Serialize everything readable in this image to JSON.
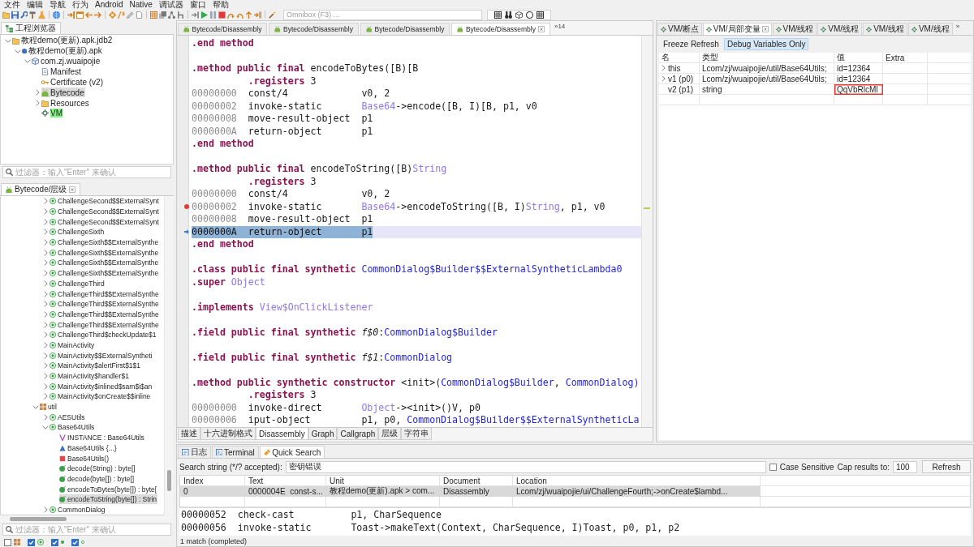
{
  "menu": [
    "文件",
    "编辑",
    "导航",
    "行为",
    "Android",
    "Native",
    "调试器",
    "窗口",
    "帮助"
  ],
  "toolbar": {
    "omnibox": {
      "placeholder": "Omnibox (F3) ..."
    }
  },
  "project_explorer": {
    "tab": "工程浏览器",
    "tree": [
      {
        "label": "教程demo(更新).apk.jdb2",
        "kind": "project",
        "expanded": true,
        "selected": false,
        "highlighted": false,
        "children": [
          {
            "label": "教程demo(更新).apk",
            "kind": "apk",
            "expanded": true,
            "selected": false,
            "highlighted": false,
            "children": [
              {
                "label": "com.zj.wuaipojie",
                "kind": "package-root",
                "expanded": true,
                "selected": false,
                "highlighted": false,
                "children": [
                  {
                    "label": "Manifest",
                    "kind": "manifest",
                    "selected": false,
                    "highlighted": false
                  },
                  {
                    "label": "Certificate (v2)",
                    "kind": "certificate",
                    "selected": false,
                    "highlighted": false
                  },
                  {
                    "label": "Bytecode",
                    "kind": "bytecode",
                    "expanded": false,
                    "selected": true,
                    "highlighted": false
                  },
                  {
                    "label": "Resources",
                    "kind": "resources",
                    "expanded": false,
                    "selected": false,
                    "highlighted": false
                  },
                  {
                    "label": "VM",
                    "kind": "vm",
                    "selected": false,
                    "highlighted": true
                  }
                ]
              }
            ]
          }
        ]
      }
    ],
    "filter": {
      "placeholder": "过滤器：输入\"Enter\" 来确认"
    }
  },
  "bytecode_hierarchy": {
    "tab": "Bytecode/层级",
    "continued_items": [
      {
        "label": "ChallengeSecond$$ExternalSynt",
        "kind": "class",
        "expanded": false,
        "selected": false
      },
      {
        "label": "ChallengeSecond$$ExternalSynt",
        "kind": "class",
        "expanded": false,
        "selected": false
      },
      {
        "label": "ChallengeSecond$$ExternalSynt",
        "kind": "class",
        "expanded": false,
        "selected": false
      },
      {
        "label": "ChallengeSixth",
        "kind": "class",
        "expanded": false,
        "selected": false
      },
      {
        "label": "ChallengeSixth$$ExternalSynthe",
        "kind": "class",
        "expanded": false,
        "selected": false
      },
      {
        "label": "ChallengeSixth$$ExternalSynthe",
        "kind": "class",
        "expanded": false,
        "selected": false
      },
      {
        "label": "ChallengeSixth$$ExternalSynthe",
        "kind": "class",
        "expanded": false,
        "selected": false
      },
      {
        "label": "ChallengeSixth$$ExternalSynthe",
        "kind": "class",
        "expanded": false,
        "selected": false
      },
      {
        "label": "ChallengeThird",
        "kind": "class",
        "expanded": false,
        "selected": false
      },
      {
        "label": "ChallengeThird$$ExternalSynthe",
        "kind": "class",
        "expanded": false,
        "selected": false
      },
      {
        "label": "ChallengeThird$$ExternalSynthe",
        "kind": "class",
        "expanded": false,
        "selected": false
      },
      {
        "label": "ChallengeThird$$ExternalSynthe",
        "kind": "class",
        "expanded": false,
        "selected": false
      },
      {
        "label": "ChallengeThird$$ExternalSynthe",
        "kind": "class",
        "expanded": false,
        "selected": false
      },
      {
        "label": "ChallengeThird$checkUpdate$1",
        "kind": "class",
        "expanded": false,
        "selected": false
      },
      {
        "label": "MainActivity",
        "kind": "class",
        "expanded": false,
        "selected": false
      },
      {
        "label": "MainActivity$$ExternalSyntheti",
        "kind": "class",
        "expanded": false,
        "selected": false
      },
      {
        "label": "MainActivity$alertFirst$1$1",
        "kind": "class",
        "expanded": false,
        "selected": false
      },
      {
        "label": "MainActivity$handler$1",
        "kind": "class",
        "expanded": false,
        "selected": false
      },
      {
        "label": "MainActivity$inlined$sam$i$an",
        "kind": "class",
        "expanded": false,
        "selected": false
      },
      {
        "label": "MainActivity$onCreate$$inline",
        "kind": "class",
        "expanded": false,
        "selected": false
      }
    ],
    "items": [
      {
        "label": "util",
        "kind": "package",
        "expanded": true,
        "selected": false,
        "children": [
          {
            "label": "AESUtils",
            "kind": "class",
            "expanded": false,
            "selected": false
          },
          {
            "label": "Base64Utils",
            "kind": "class",
            "expanded": true,
            "selected": false,
            "children": [
              {
                "label": "INSTANCE : Base64Utils",
                "kind": "field",
                "selected": false
              },
              {
                "label": "Base64Utils {...}",
                "kind": "static-init",
                "selected": false
              },
              {
                "label": "Base64Utils()",
                "kind": "constructor",
                "selected": false
              },
              {
                "label": "decode(String) : byte[]",
                "kind": "method",
                "selected": false
              },
              {
                "label": "decode(byte[]) : byte[]",
                "kind": "method",
                "selected": false
              },
              {
                "label": "encodeToBytes(byte[]) : byte[",
                "kind": "method",
                "selected": false
              },
              {
                "label": "encodeToString(byte[]) : Strin",
                "kind": "method",
                "selected": true
              }
            ]
          },
          {
            "label": "CommonDialog",
            "kind": "class",
            "expanded": false,
            "selected": false
          }
        ]
      }
    ],
    "filter": {
      "placeholder": "过滤器：输入\"Enter\" 来确认"
    },
    "filters": [
      {
        "kind": "package",
        "checked": false
      },
      {
        "kind": "class",
        "checked": true
      },
      {
        "kind": "method",
        "checked": true
      },
      {
        "kind": "field",
        "checked": true
      }
    ]
  },
  "editor": {
    "tabs": [
      {
        "label": "Bytecode/Disassembly",
        "selected": false
      },
      {
        "label": "Bytecode/Disassembly",
        "selected": false
      },
      {
        "label": "Bytecode/Disassembly",
        "selected": false
      },
      {
        "label": "Bytecode/Disassembly",
        "selected": true
      }
    ],
    "overflow": "»14",
    "lines": [
      {
        "kind": "directive",
        "tokens": [
          {
            "text": ".end method",
            "kind": "kw"
          }
        ]
      },
      {
        "kind": "blank"
      },
      {
        "kind": "directive",
        "tokens": [
          {
            "text": ".method public final",
            "kind": "kw"
          },
          {
            "text": " encodeToBytes([B)[B",
            "kind": "plain"
          }
        ]
      },
      {
        "kind": "nested",
        "tokens": [
          {
            "text": ".registers",
            "kind": "kw"
          },
          {
            "text": " 3",
            "kind": "plain"
          }
        ]
      },
      {
        "kind": "instruction",
        "address": "00000000",
        "op": "const/4",
        "args": [
          {
            "text": "v0, 2",
            "kind": "plain"
          }
        ],
        "breakpoint": false,
        "current": false
      },
      {
        "kind": "instruction",
        "address": "00000002",
        "op": "invoke-static",
        "args": [
          {
            "text": "Base64",
            "kind": "type"
          },
          {
            "text": "->encode([B, I)[B, p1, v0",
            "kind": "plain"
          }
        ],
        "breakpoint": false,
        "current": false
      },
      {
        "kind": "instruction",
        "address": "00000008",
        "op": "move-result-object",
        "args": [
          {
            "text": "p1",
            "kind": "plain"
          }
        ],
        "breakpoint": false,
        "current": false
      },
      {
        "kind": "instruction",
        "address": "0000000A",
        "op": "return-object",
        "args": [
          {
            "text": "p1",
            "kind": "plain"
          }
        ],
        "breakpoint": false,
        "current": false
      },
      {
        "kind": "directive",
        "tokens": [
          {
            "text": ".end method",
            "kind": "kw"
          }
        ]
      },
      {
        "kind": "blank"
      },
      {
        "kind": "directive",
        "tokens": [
          {
            "text": ".method public final",
            "kind": "kw"
          },
          {
            "text": " encodeToString([B)",
            "kind": "plain"
          },
          {
            "text": "String",
            "kind": "type"
          }
        ]
      },
      {
        "kind": "nested",
        "tokens": [
          {
            "text": ".registers",
            "kind": "kw"
          },
          {
            "text": " 3",
            "kind": "plain"
          }
        ]
      },
      {
        "kind": "instruction",
        "address": "00000000",
        "op": "const/4",
        "args": [
          {
            "text": "v0, 2",
            "kind": "plain"
          }
        ],
        "breakpoint": false,
        "current": false
      },
      {
        "kind": "instruction",
        "address": "00000002",
        "op": "invoke-static",
        "args": [
          {
            "text": "Base64",
            "kind": "type"
          },
          {
            "text": "->encodeToString([B, I)",
            "kind": "plain"
          },
          {
            "text": "String",
            "kind": "type"
          },
          {
            "text": ", p1, v0",
            "kind": "plain"
          }
        ],
        "breakpoint": true,
        "current": false
      },
      {
        "kind": "instruction",
        "address": "00000008",
        "op": "move-result-object",
        "args": [
          {
            "text": "p1",
            "kind": "plain"
          }
        ],
        "breakpoint": false,
        "current": false
      },
      {
        "kind": "instruction",
        "address": "0000000A",
        "op": "return-object",
        "args": [
          {
            "text": "p1",
            "kind": "plain"
          }
        ],
        "breakpoint": false,
        "current": true
      },
      {
        "kind": "directive",
        "tokens": [
          {
            "text": ".end method",
            "kind": "kw"
          }
        ]
      },
      {
        "kind": "blank"
      },
      {
        "kind": "directive",
        "tokens": [
          {
            "text": ".class public final synthetic",
            "kind": "kw"
          },
          {
            "text": " CommonDialog$Builder$$ExternalSyntheticLambda0",
            "kind": "ref"
          }
        ]
      },
      {
        "kind": "directive",
        "tokens": [
          {
            "text": ".super",
            "kind": "kw"
          },
          {
            "text": " Object",
            "kind": "type"
          }
        ]
      },
      {
        "kind": "blank"
      },
      {
        "kind": "directive",
        "tokens": [
          {
            "text": ".implements",
            "kind": "kw"
          },
          {
            "text": " View$OnClickListener",
            "kind": "type"
          }
        ]
      },
      {
        "kind": "blank"
      },
      {
        "kind": "directive",
        "tokens": [
          {
            "text": ".field public final synthetic",
            "kind": "kw"
          },
          {
            "text": " f$0",
            "kind": "name"
          },
          {
            "text": ":",
            "kind": "plain"
          },
          {
            "text": "CommonDialog$Builder",
            "kind": "ref"
          }
        ]
      },
      {
        "kind": "blank"
      },
      {
        "kind": "directive",
        "tokens": [
          {
            "text": ".field public final synthetic",
            "kind": "kw"
          },
          {
            "text": " f$1",
            "kind": "name"
          },
          {
            "text": ":",
            "kind": "plain"
          },
          {
            "text": "CommonDialog",
            "kind": "ref"
          }
        ]
      },
      {
        "kind": "blank"
      },
      {
        "kind": "directive",
        "tokens": [
          {
            "text": ".method public synthetic constructor",
            "kind": "kw"
          },
          {
            "text": " <init>(",
            "kind": "plain"
          },
          {
            "text": "CommonDialog$Builder",
            "kind": "ref"
          },
          {
            "text": ", ",
            "kind": "plain"
          },
          {
            "text": "CommonDialog)",
            "kind": "ref"
          }
        ]
      },
      {
        "kind": "nested",
        "tokens": [
          {
            "text": ".registers",
            "kind": "kw"
          },
          {
            "text": " 3",
            "kind": "plain"
          }
        ]
      },
      {
        "kind": "instruction",
        "address": "00000000",
        "op": "invoke-direct",
        "args": [
          {
            "text": "Object",
            "kind": "type"
          },
          {
            "text": "-><init>()V, p0",
            "kind": "plain"
          }
        ],
        "breakpoint": false,
        "current": false
      },
      {
        "kind": "instruction",
        "address": "00000006",
        "op": "iput-object",
        "args": [
          {
            "text": "p1, p0, ",
            "kind": "plain"
          },
          {
            "text": "CommonDialog$Builder$$ExternalSyntheticLa",
            "kind": "ref"
          }
        ],
        "breakpoint": false,
        "current": false
      }
    ],
    "view_tabs": [
      {
        "label": "描述",
        "selected": false
      },
      {
        "label": "十六进制格式",
        "selected": false
      },
      {
        "label": "Disassembly",
        "selected": true
      },
      {
        "label": "Graph",
        "selected": false
      },
      {
        "label": "Callgraph",
        "selected": false
      },
      {
        "label": "层级",
        "selected": false
      },
      {
        "label": "字符串",
        "selected": false
      }
    ]
  },
  "vm_panel": {
    "tabs": [
      {
        "label": "VM/断点",
        "selected": false
      },
      {
        "label": "VM/局部变量",
        "selected": true
      },
      {
        "label": "VM/线程",
        "selected": false
      },
      {
        "label": "VM/线程",
        "selected": false
      },
      {
        "label": "VM/线程",
        "selected": false
      },
      {
        "label": "VM/线程",
        "selected": false
      }
    ],
    "overflow": "»",
    "buttons": [
      {
        "label": "Freeze Refresh",
        "selected": false
      },
      {
        "label": "Debug Variables Only",
        "selected": true
      }
    ],
    "columns": [
      "名",
      "类型",
      "值",
      "Extra"
    ],
    "rows": [
      {
        "kind": "object",
        "expanded": false,
        "name": "this",
        "type": "Lcom/zj/wuaipojie/util/Base64Utils;",
        "value": "id=12364",
        "highlighted": false
      },
      {
        "kind": "object",
        "expanded": false,
        "name": "v1 (p0)",
        "type": "Lcom/zj/wuaipojie/util/Base64Utils;",
        "value": "id=12364",
        "highlighted": false
      },
      {
        "kind": "primitive",
        "name": "v2 (p1)",
        "type": "string",
        "value": "QqVbRlcMl",
        "highlighted": true
      }
    ]
  },
  "bottom_panel": {
    "tabs": [
      {
        "label": "日志",
        "kind": "log",
        "selected": false
      },
      {
        "label": "Terminal",
        "kind": "terminal",
        "selected": false
      },
      {
        "label": "Quick Search",
        "kind": "search",
        "selected": true
      }
    ],
    "search": {
      "label": "Search string (*/? accepted):",
      "value": "密钥错误",
      "case_sensitive": {
        "label": "Case Sensitive",
        "checked": false
      },
      "cap_label": "Cap results to:",
      "cap_value": "100",
      "button": "Refresh"
    },
    "results": {
      "columns": [
        "Index",
        "Text",
        "Unit",
        "Document",
        "Location"
      ],
      "rows": [
        {
          "cells": [
            "0",
            "0000004E  const-s...",
            "教程demo(更新).apk > com...",
            "Disassembly",
            "Lcom/zj/wuaipojie/ui/ChallengeFourth;->onCreate$lambd..."
          ],
          "selected": true
        }
      ]
    },
    "preview": [
      {
        "address": "00000052",
        "op": "check-cast",
        "args": "p1, CharSequence"
      },
      {
        "address": "00000056",
        "op": "invoke-static",
        "args": "Toast->makeText(Context, CharSequence, I)Toast, p0, p1, p2"
      }
    ],
    "status": "1 match (completed)"
  }
}
